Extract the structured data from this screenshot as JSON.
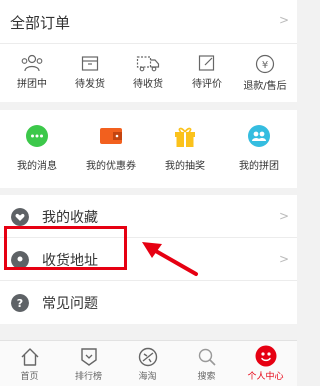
{
  "orders": {
    "title": "全部订单",
    "status_items": [
      {
        "label": "拼团中",
        "icon": "group-people-icon"
      },
      {
        "label": "待发货",
        "icon": "box-icon"
      },
      {
        "label": "待收货",
        "icon": "truck-icon"
      },
      {
        "label": "待评价",
        "icon": "edit-icon"
      },
      {
        "label": "退款/售后",
        "icon": "refund-icon"
      }
    ]
  },
  "features": [
    {
      "label": "我的消息",
      "icon": "message-icon",
      "color": "#3cc84a"
    },
    {
      "label": "我的优惠券",
      "icon": "coupon-icon",
      "color": "#f2601e"
    },
    {
      "label": "我的抽奖",
      "icon": "gift-icon",
      "color": "#fbc21b"
    },
    {
      "label": "我的拼团",
      "icon": "group-icon",
      "color": "#35bde0"
    }
  ],
  "list": [
    {
      "label": "我的收藏",
      "icon": "heart-icon"
    },
    {
      "label": "收货地址",
      "icon": "location-icon"
    },
    {
      "label": "常见问题",
      "icon": "question-icon"
    }
  ],
  "tabbar": [
    {
      "label": "首页",
      "icon": "home-icon",
      "active": false
    },
    {
      "label": "排行榜",
      "icon": "ranking-icon",
      "active": false
    },
    {
      "label": "海淘",
      "icon": "plane-icon",
      "active": false
    },
    {
      "label": "搜索",
      "icon": "search-icon",
      "active": false
    },
    {
      "label": "个人中心",
      "icon": "user-center-icon",
      "active": true
    }
  ],
  "colors": {
    "accent": "#e60012",
    "icon_gray": "#5e6266"
  }
}
